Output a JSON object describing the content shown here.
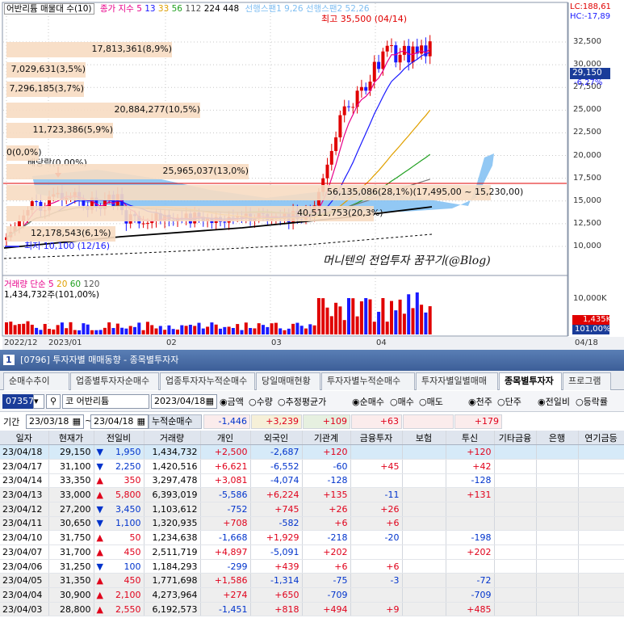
{
  "chart": {
    "title_stock": "어반리튬 매물대 수(10)",
    "legend": {
      "label": "종가 지수",
      "ma_values": [
        "5",
        "13",
        "33",
        "56",
        "112",
        "224",
        "448"
      ],
      "ma_colors": [
        "#e8008a",
        "#1a1aff",
        "#e0a000",
        "#20a020",
        "#555555",
        "#000000",
        "#000000"
      ],
      "span_text": "선행스팬1 9,26  선행스팬2 52,26"
    },
    "top_right": {
      "lc": "LC:188,61",
      "hc": "HC:-17,89"
    },
    "high_label": "최고 35,500 (04/14)",
    "low_label": "최저 10,100 (12/16)",
    "dividend_label": "배당락(0,00%)",
    "price_label": "29,150",
    "change_label": "-6,27%",
    "y_axis": [
      "32,500",
      "30,000",
      "27,500",
      "25,000",
      "22,500",
      "20,000",
      "17,500",
      "15,000",
      "12,500",
      "10,000"
    ],
    "volume_profile": [
      {
        "text": "17,813,361(8,9%)"
      },
      {
        "text": "7,029,631(3,5%)"
      },
      {
        "text": "7,296,185(3,7%)"
      },
      {
        "text": "20,884,277(10,5%)"
      },
      {
        "text": "11,723,386(5,9%)"
      },
      {
        "text": "0(0,0%)"
      },
      {
        "text": "25,965,037(13,0%)"
      },
      {
        "text": "56,135,086(28,1%)(17,495,00 ~ 15,230,00)"
      },
      {
        "text": "40,511,753(20,3%)"
      },
      {
        "text": "12,178,543(6,1%)"
      }
    ],
    "watermark": "머니텐의 전업투자 꿈꾸기(@Blog)",
    "volume_pane": {
      "title": "거래량",
      "ma_label": "단순",
      "ma_values": [
        "5",
        "20",
        "60",
        "120"
      ],
      "ma_colors": [
        "#e8008a",
        "#e0a000",
        "#20a020",
        "#555555"
      ],
      "current": "1,434,732주(101,00%)",
      "y_axis": [
        "10,000K",
        "5,000K"
      ],
      "vol_badge": "1,435K",
      "pct_badge": "101,00%"
    },
    "x_axis": [
      "2022/12",
      "2023/01",
      "02",
      "03",
      "04",
      "04/18"
    ]
  },
  "window": {
    "title": "[0796] 투자자별 매매동향 - 종목별투자자",
    "num": "1"
  },
  "tabs": [
    {
      "label": "순매수추이",
      "active": false
    },
    {
      "label": "업종별투자자순매수",
      "active": false
    },
    {
      "label": "업종투자자누적순매수",
      "active": false
    },
    {
      "label": "당일매매현황",
      "active": false
    },
    {
      "label": "투자자별누적순매수",
      "active": false
    },
    {
      "label": "투자자별일별매매",
      "active": false
    },
    {
      "label": "종목별투자자",
      "active": true
    },
    {
      "label": "프로그램",
      "active": false
    }
  ],
  "toolbar": {
    "code": "073570",
    "code_prefix": "코",
    "stock_name": "어반리튬",
    "date": "2023/04/18",
    "radios1": [
      {
        "label": "금액",
        "checked": true
      },
      {
        "label": "수량",
        "checked": false
      },
      {
        "label": "추정평균가",
        "checked": false
      }
    ],
    "radios2": [
      {
        "label": "순매수",
        "checked": true
      },
      {
        "label": "매수",
        "checked": false
      },
      {
        "label": "매도",
        "checked": false
      }
    ],
    "radios3": [
      {
        "label": "천주",
        "checked": true
      },
      {
        "label": "단주",
        "checked": false
      }
    ],
    "radios4": [
      {
        "label": "전일비",
        "checked": true
      },
      {
        "label": "등락률",
        "checked": false
      }
    ],
    "period_label": "기간",
    "from_date": "23/03/18",
    "to_date": "23/04/18",
    "cum_label": "누적순매수",
    "cum_values": [
      "-1,446",
      "+3,239",
      "+109",
      "+63",
      "",
      "+179"
    ]
  },
  "table": {
    "headers": [
      "일자",
      "현재가",
      "전일비",
      "거래량",
      "개인",
      "외국인",
      "기관계",
      "금융투자",
      "보험",
      "투신",
      "기타금융",
      "은행",
      "연기금등"
    ],
    "rows": [
      {
        "date": "23/04/18",
        "price": "29,150",
        "dir": "down",
        "diff": "1,950",
        "vol": "1,434,732",
        "ind": "+2,500",
        "fgn": "-2,687",
        "inst": "+120",
        "fin": "",
        "ins": "",
        "trust": "+120"
      },
      {
        "date": "23/04/17",
        "price": "31,100",
        "dir": "down",
        "diff": "2,250",
        "vol": "1,420,516",
        "ind": "+6,621",
        "fgn": "-6,552",
        "inst": "-60",
        "fin": "+45",
        "ins": "",
        "trust": "+42"
      },
      {
        "date": "23/04/14",
        "price": "33,350",
        "dir": "up",
        "diff": "350",
        "vol": "3,297,478",
        "ind": "+3,081",
        "fgn": "-4,074",
        "inst": "-128",
        "fin": "",
        "ins": "",
        "trust": "-128"
      },
      {
        "date": "23/04/13",
        "price": "33,000",
        "dir": "up",
        "diff": "5,800",
        "vol": "6,393,019",
        "ind": "-5,586",
        "fgn": "+6,224",
        "inst": "+135",
        "fin": "-11",
        "ins": "",
        "trust": "+131"
      },
      {
        "date": "23/04/12",
        "price": "27,200",
        "dir": "down",
        "diff": "3,450",
        "vol": "1,103,612",
        "ind": "-752",
        "fgn": "+745",
        "inst": "+26",
        "fin": "+26",
        "ins": "",
        "trust": ""
      },
      {
        "date": "23/04/11",
        "price": "30,650",
        "dir": "down",
        "diff": "1,100",
        "vol": "1,320,935",
        "ind": "+708",
        "fgn": "-582",
        "inst": "+6",
        "fin": "+6",
        "ins": "",
        "trust": ""
      },
      {
        "date": "23/04/10",
        "price": "31,750",
        "dir": "up",
        "diff": "50",
        "vol": "1,234,638",
        "ind": "-1,668",
        "fgn": "+1,929",
        "inst": "-218",
        "fin": "-20",
        "ins": "",
        "trust": "-198"
      },
      {
        "date": "23/04/07",
        "price": "31,700",
        "dir": "up",
        "diff": "450",
        "vol": "2,511,719",
        "ind": "+4,897",
        "fgn": "-5,091",
        "inst": "+202",
        "fin": "",
        "ins": "",
        "trust": "+202"
      },
      {
        "date": "23/04/06",
        "price": "31,250",
        "dir": "down",
        "diff": "100",
        "vol": "1,184,293",
        "ind": "-299",
        "fgn": "+439",
        "inst": "+6",
        "fin": "+6",
        "ins": "",
        "trust": ""
      },
      {
        "date": "23/04/05",
        "price": "31,350",
        "dir": "up",
        "diff": "450",
        "vol": "1,771,698",
        "ind": "+1,586",
        "fgn": "-1,314",
        "inst": "-75",
        "fin": "-3",
        "ins": "",
        "trust": "-72"
      },
      {
        "date": "23/04/04",
        "price": "30,900",
        "dir": "up",
        "diff": "2,100",
        "vol": "4,273,964",
        "ind": "+274",
        "fgn": "+650",
        "inst": "-709",
        "fin": "",
        "ins": "",
        "trust": "-709"
      },
      {
        "date": "23/04/03",
        "price": "28,800",
        "dir": "up",
        "diff": "2,550",
        "vol": "6,192,573",
        "ind": "-1,451",
        "fgn": "+818",
        "inst": "+494",
        "fin": "+9",
        "ins": "",
        "trust": "+485"
      }
    ]
  }
}
